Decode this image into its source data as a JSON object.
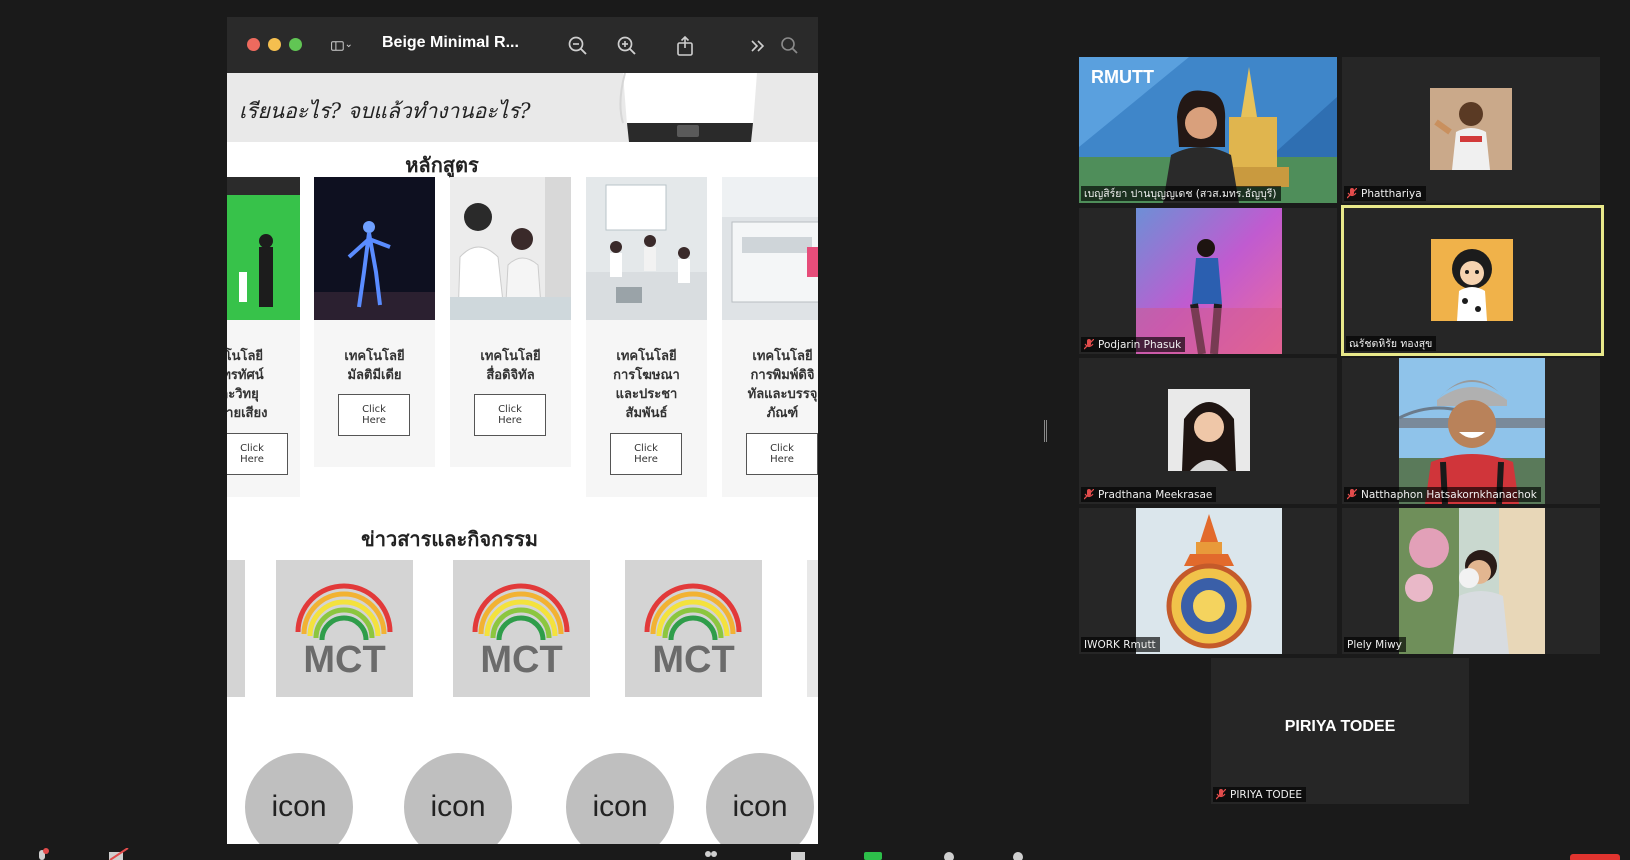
{
  "preview": {
    "title": "Beige Minimal R...",
    "traffic_colors": [
      "#ed6a5e",
      "#f5bf4f",
      "#61c554"
    ]
  },
  "document": {
    "hero_text": "เรียนอะไร? จบแล้วทำงานอะไร?",
    "courses_title": "หลักสูตร",
    "courses": [
      {
        "name": "คโนโลยี\nโทรทัศน์\nละวิทยุ\nะจายเสียง",
        "button": "Click\nHere"
      },
      {
        "name": "เทคโนโลยี\nมัลติมีเดีย",
        "button": "Click\nHere"
      },
      {
        "name": "เทคโนโลยี\nสื่อดิจิทัล",
        "button": "Click\nHere"
      },
      {
        "name": "เทคโนโลยี\nการโฆษณา\nและประชา\nสัมพันธ์",
        "button": "Click\nHere"
      },
      {
        "name": "เทคโนโลยี\nการพิมพ์ดิจิ\nทัลและบรรจุ\nภัณฑ์",
        "button": "Click\nHere"
      }
    ],
    "news_title": "ข่าวสารและกิจกรรม",
    "news_logo_text": "MCT",
    "icon_label": "icon"
  },
  "participants": [
    {
      "name": "เบญสิร์ยา ปานบุญญเดช (สวส.มทร.ธัญบุรี)",
      "muted": false,
      "logo_text": "RMUTT"
    },
    {
      "name": "Phatthariya",
      "muted": true
    },
    {
      "name": "Podjarin Phasuk",
      "muted": true
    },
    {
      "name": "ณรัชตหิรัย ทองสุข",
      "muted": false,
      "active": true
    },
    {
      "name": "Pradthana Meekrasae",
      "muted": true
    },
    {
      "name": "Natthaphon Hatsakornkhanachok",
      "muted": true
    },
    {
      "name": "IWORK Rmutt",
      "muted": false
    },
    {
      "name": "Plely Miwy",
      "muted": false
    },
    {
      "name": "PIRIYA TODEE",
      "muted": true,
      "display": "PIRIYA TODEE"
    }
  ],
  "colors": {
    "active_speaker": "#e8e88a",
    "mic_muted": "#e24c4c",
    "mct_rainbow": [
      "#e23a3a",
      "#f2b233",
      "#f4e23d",
      "#8cc63f",
      "#2f9d4a"
    ]
  }
}
